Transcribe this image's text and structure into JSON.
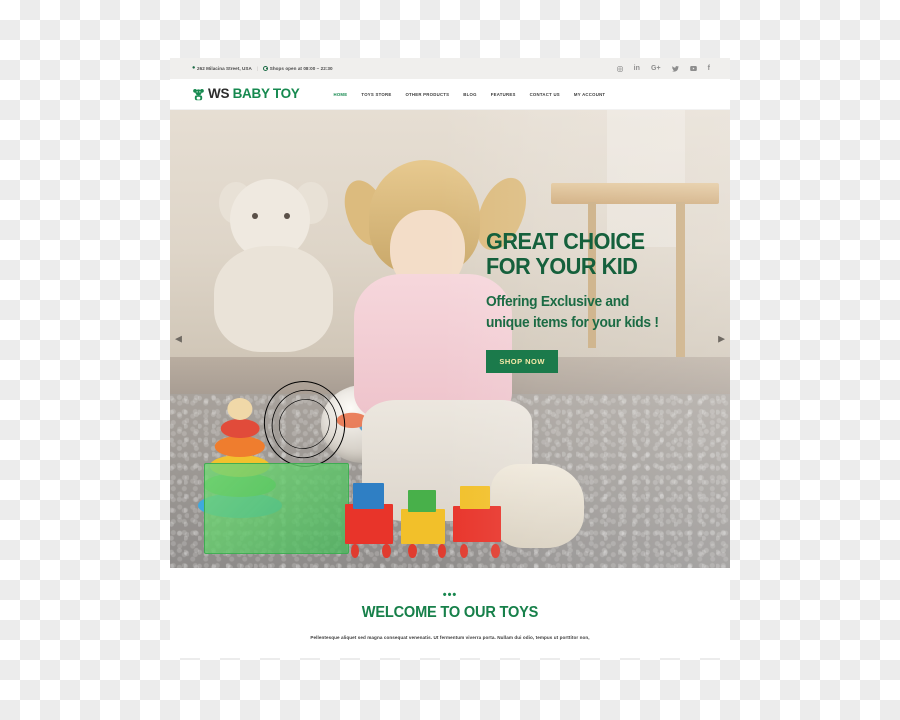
{
  "topbar": {
    "address": "262 Milacina Street, USA",
    "separator": "|",
    "hours": "Shops open at 08:00 – 22:30",
    "location_icon": "location-pin-icon",
    "clock_icon": "clock-icon",
    "social": [
      {
        "name": "instagram-icon",
        "glyph": "▣"
      },
      {
        "name": "linkedin-icon",
        "glyph": "in"
      },
      {
        "name": "googleplus-icon",
        "glyph": "G+"
      },
      {
        "name": "twitter-icon",
        "glyph": "ᴠ"
      },
      {
        "name": "youtube-icon",
        "glyph": "▶"
      },
      {
        "name": "facebook-icon",
        "glyph": "f"
      }
    ]
  },
  "header": {
    "logo": {
      "icon": "teddy-bear-icon",
      "text_primary": "WS",
      "text_accent": "BABY TOY"
    },
    "nav": [
      {
        "label": "HOME",
        "active": true
      },
      {
        "label": "TOYS STORE",
        "active": false
      },
      {
        "label": "OTHER PRODUCTS",
        "active": false
      },
      {
        "label": "BLOG",
        "active": false
      },
      {
        "label": "FEATURES",
        "active": false
      },
      {
        "label": "CONTACT US",
        "active": false
      },
      {
        "label": "MY ACCOUNT",
        "active": false
      }
    ]
  },
  "hero": {
    "title_line1": "GREAT CHOICE",
    "title_line2": "FOR YOUR KID",
    "subtitle_line1": "Offering Exclusive and",
    "subtitle_line2": "unique items for your kids !",
    "cta_label": "SHOP NOW",
    "prev_arrow": "◀",
    "next_arrow": "▶",
    "image_alt": "toddler girl playing with colorful toys on carpet"
  },
  "welcome": {
    "dots": "•••",
    "title": "WELCOME TO OUR TOYS",
    "paragraph": "Pellentesque aliquet sed magna consequat venenatis. Ut fermentum viverra porta. Nullam dui odio, tempus ut porttitor non,"
  },
  "colors": {
    "brand_green": "#16894f",
    "dark_green": "#15603c",
    "button_green": "#1b7a4b",
    "button_text": "#f6e9a8",
    "topbar_bg": "#f0efed"
  }
}
